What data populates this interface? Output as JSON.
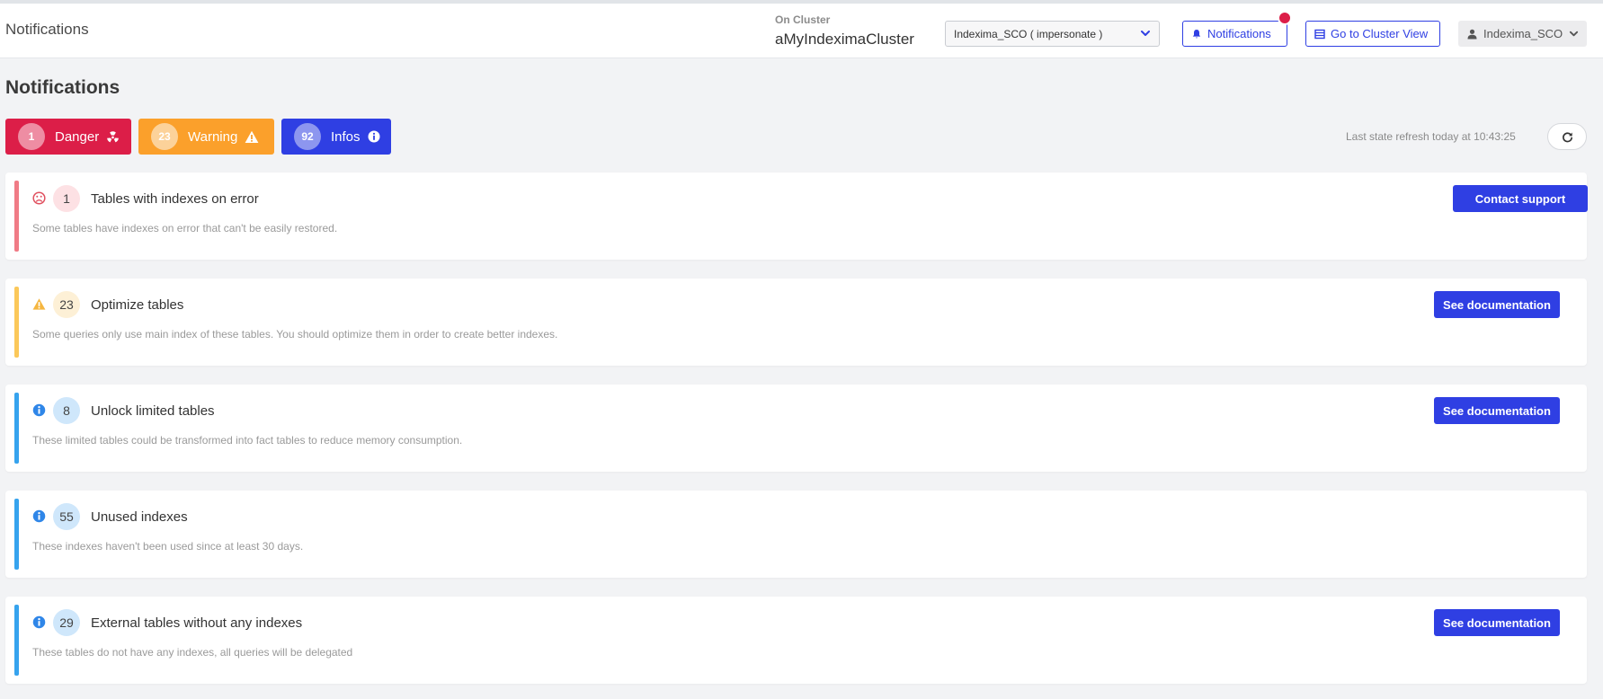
{
  "header": {
    "app_title": "Notifications",
    "cluster_label": "On Cluster",
    "cluster_name": "aMyIndeximaCluster",
    "user_select_value": "Indexima_SCO ( impersonate )",
    "notifications_label": "Notifications",
    "cluster_view_label": "Go to Cluster View",
    "user_name": "Indexima_SCO"
  },
  "page": {
    "title": "Notifications"
  },
  "filters": [
    {
      "count": "1",
      "label": "Danger",
      "icon": "radiation-icon"
    },
    {
      "count": "23",
      "label": "Warning",
      "icon": "warning-triangle-icon"
    },
    {
      "count": "92",
      "label": "Infos",
      "icon": "info-circle-icon"
    }
  ],
  "refresh": {
    "text": "Last state refresh today at 10:43:25"
  },
  "notifications": [
    {
      "level": "danger",
      "icon": "sad-face-icon",
      "count": "1",
      "title": "Tables with indexes on error",
      "description": "Some tables have indexes on error that can't be easily restored.",
      "action": "Contact support"
    },
    {
      "level": "warning",
      "icon": "warning-triangle-icon",
      "count": "23",
      "title": "Optimize tables",
      "description": "Some queries only use main index of these tables. You should optimize them in order to create better indexes.",
      "action": "See documentation"
    },
    {
      "level": "info",
      "icon": "info-circle-icon",
      "count": "8",
      "title": "Unlock limited tables",
      "description": "These limited tables could be transformed into fact tables to reduce memory consumption.",
      "action": "See documentation"
    },
    {
      "level": "info",
      "icon": "info-circle-icon",
      "count": "55",
      "title": "Unused indexes",
      "description": "These indexes haven't been used since at least 30 days.",
      "action": ""
    },
    {
      "level": "info",
      "icon": "info-circle-icon",
      "count": "29",
      "title": "External tables without any indexes",
      "description": "These tables do not have any indexes, all queries will be delegated",
      "action": "See documentation"
    }
  ],
  "colors": {
    "primary": "#2f3fe3",
    "danger": "#dc1e48",
    "warning": "#fba02b",
    "info": "#36a3ee"
  }
}
